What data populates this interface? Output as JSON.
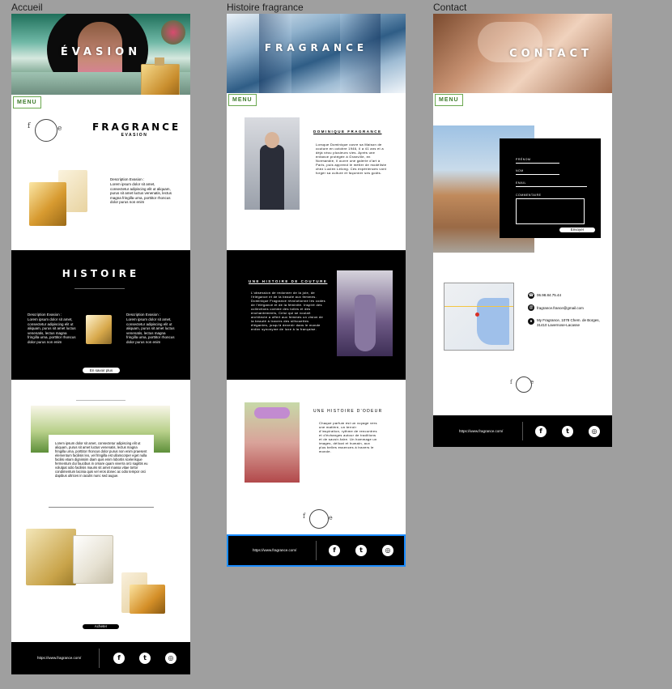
{
  "boards": {
    "accueil": "Accueil",
    "histoire": "Histoire fragrance",
    "contact": "Contact"
  },
  "common": {
    "menu": "MENU",
    "url": "https://www.fragrance.com/",
    "logo_f": "f",
    "logo_e": "e"
  },
  "accueil": {
    "hero_title": "ÉVASION",
    "brand_title": "FRAGRANCE",
    "brand_sub": "EVASION",
    "desc_title": "Description Evasion :",
    "desc_body": "Lorem ipsum dolor sit amet, consectetur adipiscing elit ut aliquam, purus sit amet luctus venenatis, lectus magna fringilla urna, porttitor rhoncus dolor purus non enim",
    "histoire_title": "HISTOIRE",
    "col_title": "Description Evasion :",
    "col_body": "Lorem ipsum dolor sit amet, consectetur adipiscing elit ut aliquam, purus sit amet luctus venenatis, lectus magna fringilla urna, porttitor rhoncus dolor purus non enim",
    "more_btn": "En savoir plus",
    "lorem_long": "Lorem ipsum dolor sit amet, consectetur adipiscing elit ut aliquam, purus sit amet luctus venenatis, lectus magna fringilla urna, porttitor rhoncus dolor purus non enim praesent elementum facilisis leo, vel fringilla est ullamcorper eget nulla facilisi etiam dignissim diam quis enim lobortis scelerisque fermentum dui faucibus in ornare quam viverra orci sagittis eu volutpat odio facilisis mauris sit amet massa vitae tortor condimentum lacinia quis vel eros donec ac odio tempor orci dapibus ultrices in iaculis nunc sed augue.",
    "buy_btn": "Acheter"
  },
  "histoire": {
    "hero_title": "FRAGRANCE",
    "s1_title": "DOMINIQUE FRAGRANCE",
    "s1_body": "Lorsque Dominique ouvre sa Maison de couture en octobre 1946, il a 41 ans et a déjà vécu plusieurs vies. Après une enfance protégée à Granville, en Normandie, il ouvre une galerie d'art à Paris, puis apprend le métier de modéliste chez Lucien Lelong. Ces expériences vont forger sa culture et façonner ses goûts.",
    "s2_title": "UNE HISTOIRE DE COUTURE",
    "s2_body": "L'obsession de redonner de la joie, de l'élégance et de la beauté aux femmes. Dominique Fragrance révolutionne les codes de l'élégance et de la féminité. Inspiré des collections comme des toiles et des enchantements, Celui qui se voulait architecte a offert aux femmes un vision de la beauté à travers des silhouettes élégantes, jusqu'à devenir dans le monde entier synonyme de luxe à la française.",
    "s3_title": "UNE HISTOIRE D'ODEUR",
    "s3_body": "Chaque parfum est un voyage vers une matière, un terroir d'inspiration, rythme de rencontres et d'échanges autour de traditions et de savoir-faire. Un hommage un images, délicat et humain, aux plus belles essences à travers le monde."
  },
  "contact": {
    "hero_title": "CONTACT",
    "form": {
      "prenom": "PRÉNOM",
      "nom": "NOM",
      "email": "EMAIL",
      "commentaire": "COMMENTAIRE",
      "submit": "Envoyer"
    },
    "phone": "06.98.84.75.44",
    "email": "fragrance.france@gmail.com",
    "address": "My Fragrance, 1078 Chem. de Borges, 31410 Lavernose-Lacasse"
  },
  "colors": {
    "accent_green": "#6aa84f",
    "selection_blue": "#1a8cff",
    "black": "#000000"
  }
}
